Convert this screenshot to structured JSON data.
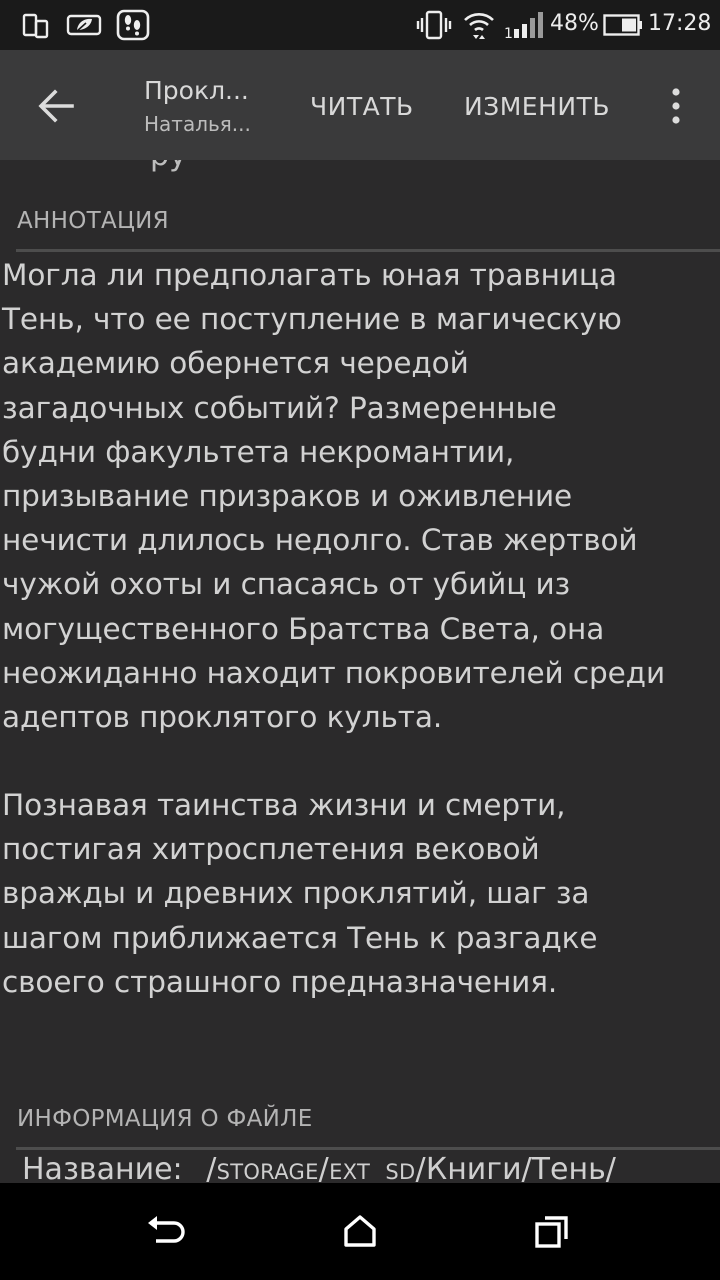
{
  "status_bar": {
    "battery_percent": "48%",
    "time": "17:28",
    "icons": [
      "screen-mirror-icon",
      "leaf-notification-icon",
      "steps-notification-icon",
      "vibrate-icon",
      "wifi-icon",
      "signal-icon",
      "battery-icon"
    ]
  },
  "toolbar": {
    "title": "Прокл...",
    "subtitle": "Наталья...",
    "read_label": "ЧИТАТЬ",
    "edit_label": "ИЗМЕНИТЬ"
  },
  "content": {
    "cut_text": "ру",
    "annotation_header": "АННОТАЦИЯ",
    "paragraphs": [
      "Могла ли предполагать юная травница\nТень, что ее поступление в магическую\nакадемию обернется чередой\nзагадочных событий? Размеренные\nбудни факультета некромантии,\nпризывание призраков и оживление\nнечисти длилось недолго. Став жертвой\nчужой охоты и спасаясь от убийц из\nмогущественного Братства Света, она\nнеожиданно находит покровителей среди\nадептов проклятого культа.",
      "Познавая таинства жизни и смерти,\nпостигая хитросплетения вековой\nвражды и древних проклятий, шаг за\nшагом приближается Тень к разгадке\nсвоего страшного предназначения."
    ],
    "file_info_header": "ИНФОРМАЦИЯ О ФАЙЛЕ",
    "file_name_label": "Название:",
    "file_path_prefix": "/storage/ext_sd/",
    "file_path_folder": "Книги/Тень/"
  },
  "colors": {
    "background": "#2b2a2b",
    "toolbar": "#3a3a3b",
    "status_bar": "#1a1a1a",
    "nav_bar": "#000000",
    "text": "#d2d2d2"
  }
}
